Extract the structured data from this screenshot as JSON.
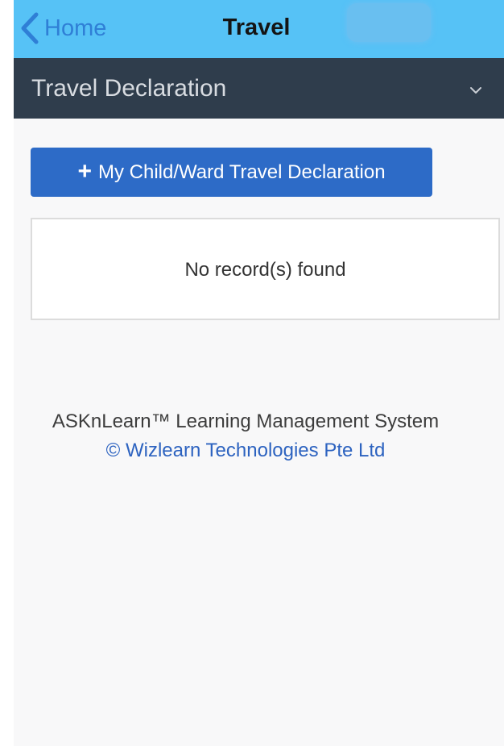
{
  "navbar": {
    "back_label": "Home",
    "title": "Travel"
  },
  "section": {
    "title": "Travel Declaration"
  },
  "actions": {
    "add_label": "My Child/Ward Travel Declaration",
    "add_icon": "plus-icon"
  },
  "records": {
    "empty_message": "No record(s) found"
  },
  "footer": {
    "product": "ASKnLearn™ Learning Management System",
    "copyright": "© Wizlearn Technologies Pte Ltd"
  },
  "colors": {
    "navbar_bg": "#56c2f6",
    "section_bg": "#2f3d4c",
    "primary_button": "#2d6bc7",
    "link": "#2d63c0",
    "back_link": "#2f7fd6"
  }
}
